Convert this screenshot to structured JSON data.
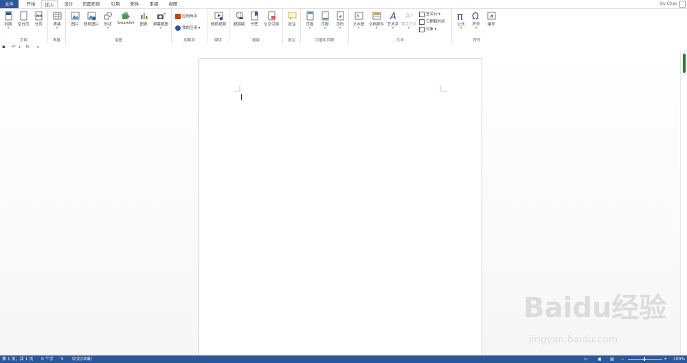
{
  "tabs": [
    "文件",
    "开始",
    "插入",
    "设计",
    "页面布局",
    "引用",
    "邮件",
    "审阅",
    "视图"
  ],
  "user_name": "Qu Chao",
  "ribbon": {
    "pages": {
      "label": "页面",
      "cover": "封面",
      "blank": "空白页",
      "break": "分页"
    },
    "tables": {
      "label": "表格",
      "table": "表格"
    },
    "illustrations": {
      "label": "插图",
      "picture": "图片",
      "online_picture": "联机图片",
      "shapes": "形状",
      "smartart": "SmartArt",
      "chart": "图表",
      "screenshot": "屏幕截图"
    },
    "addins": {
      "label": "加载项",
      "store": "应用商店",
      "my_apps": "我的应用"
    },
    "media": {
      "label": "媒体",
      "online_video": "联机视频"
    },
    "links": {
      "label": "链接",
      "hyperlink": "超链接",
      "bookmark": "书签",
      "cross_ref": "交叉引用"
    },
    "comments": {
      "label": "批注",
      "comment": "批注"
    },
    "header_footer": {
      "label": "页眉和页脚",
      "header": "页眉",
      "footer": "页脚",
      "page_number": "页码"
    },
    "text": {
      "label": "文本",
      "textbox": "文本框",
      "quick_parts": "文档部件",
      "wordart": "艺术字",
      "dropcap": "首字下沉",
      "signature": "签名行",
      "datetime": "日期和时间",
      "object": "对象"
    },
    "symbols": {
      "label": "符号",
      "equation": "公式",
      "symbol": "符号",
      "number": "编号"
    }
  },
  "status": {
    "page": "第 1 页，共 1 页",
    "words": "0 个字",
    "language": "中文(中国)",
    "zoom": "100%"
  },
  "watermark": {
    "main": "Baidu经验",
    "sub": "jingyan.baidu.com"
  },
  "colors": {
    "accent": "#2b579a"
  }
}
